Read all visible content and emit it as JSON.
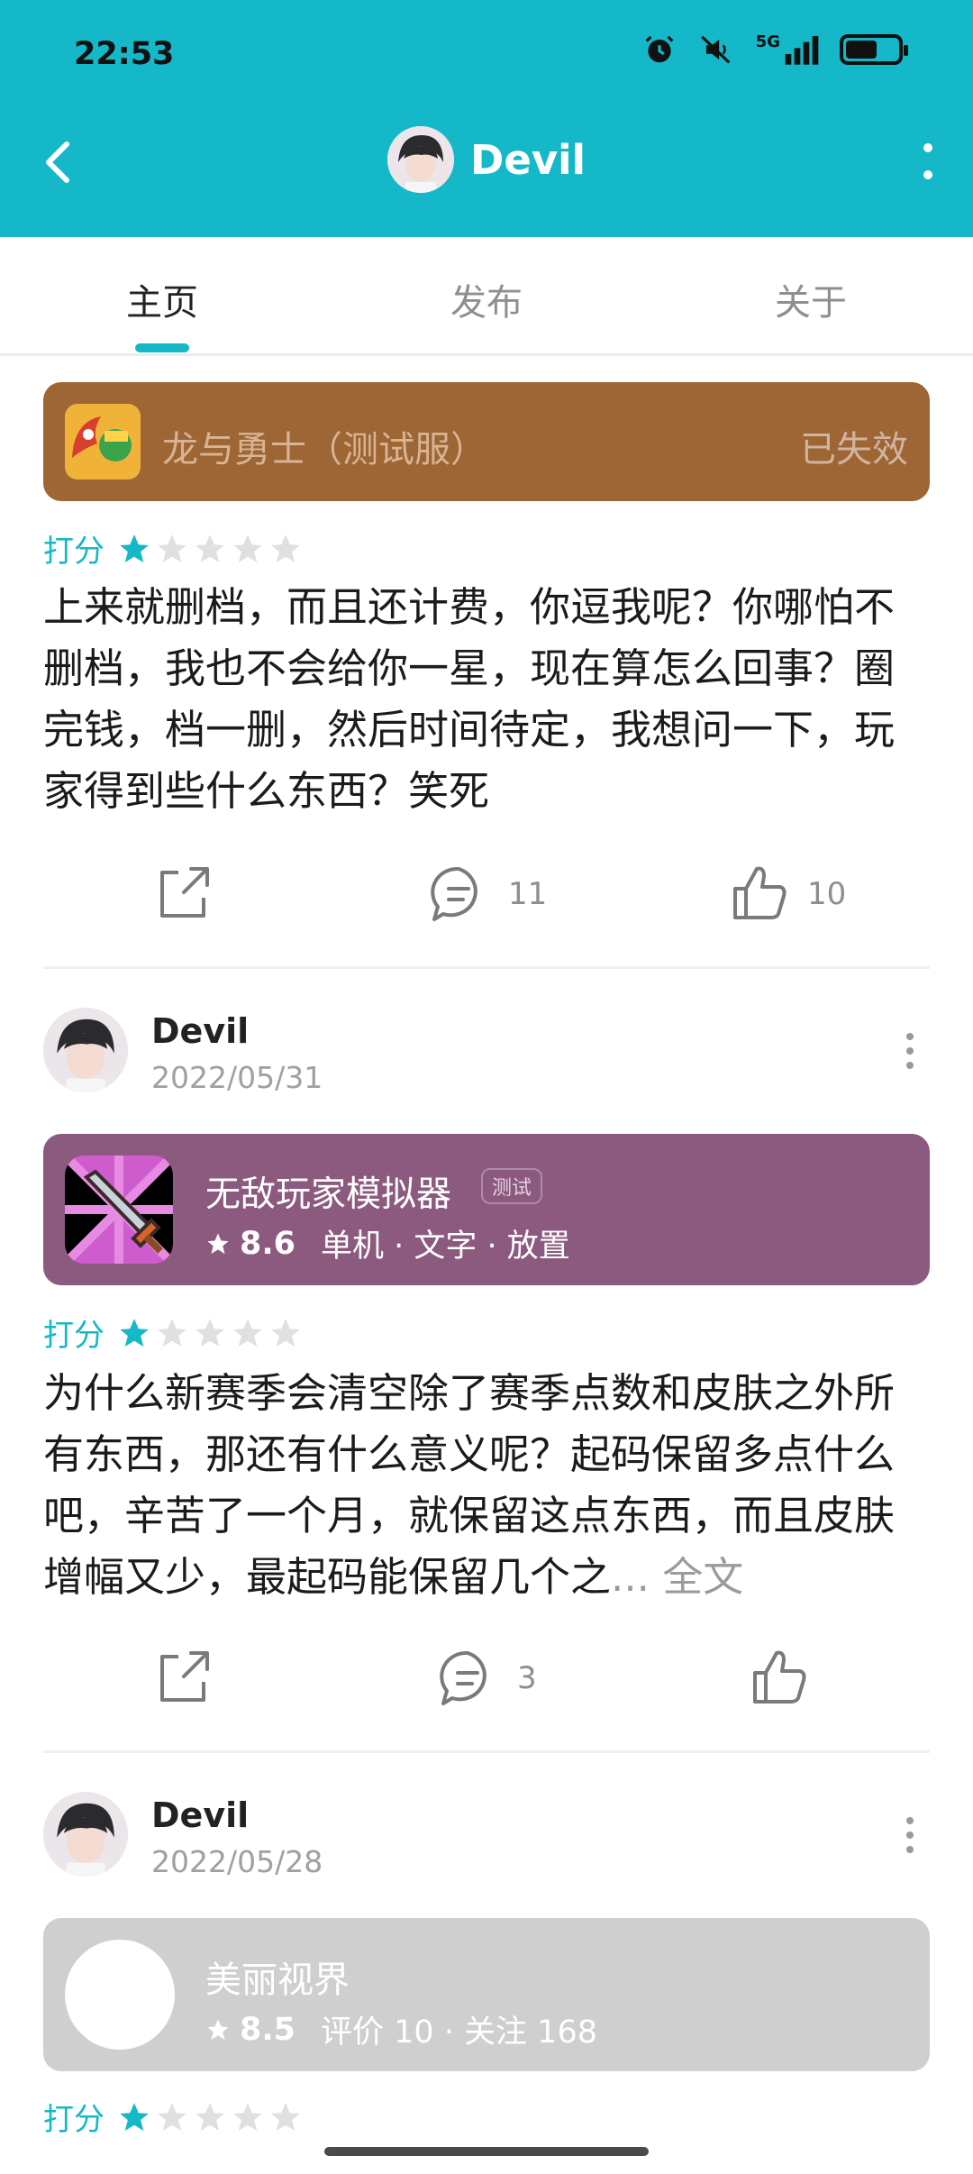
{
  "status_bar": {
    "time": "22:53",
    "network_label": "5G",
    "battery_level": 0.6,
    "icons": [
      "alarm-icon",
      "mute-icon",
      "signal-icon",
      "battery-icon"
    ]
  },
  "nav": {
    "title": "Devil",
    "back_icon": "back-arrow-icon",
    "more_icon": "more-vertical-icon"
  },
  "tabs": [
    {
      "label": "主页",
      "active": true
    },
    {
      "label": "发布",
      "active": false
    },
    {
      "label": "关于",
      "active": false
    }
  ],
  "reviews": [
    {
      "game": {
        "title": "龙与勇士（测试服）",
        "status": "已失效",
        "card_color": "#9e6535"
      },
      "rating_label": "打分",
      "stars": 1,
      "text": "上来就删档，而且还计费，你逗我呢？你哪怕不删档，我也不会给你一星，现在算怎么回事？圈完钱，档一删，然后时间待定，我想问一下，玩家得到些什么东西？笑死",
      "actions": {
        "comments": "11",
        "likes": "10"
      }
    },
    {
      "user": {
        "name": "Devil",
        "date": "2022/05/31"
      },
      "game": {
        "title": "无敌玩家模拟器",
        "badge": "测试",
        "score": "8.6",
        "tags": "单机 · 文字 · 放置",
        "card_color": "#8b5a7e"
      },
      "rating_label": "打分",
      "stars": 1,
      "text": "为什么新赛季会清空除了赛季点数和皮肤之外所有东西，那还有什么意义呢？起码保留多点什么吧，辛苦了一个月，就保留这点东西，而且皮肤增幅又少，最起码能保留几个之",
      "more_label": "... 全文",
      "actions": {
        "comments": "3",
        "likes": ""
      }
    },
    {
      "user": {
        "name": "Devil",
        "date": "2022/05/28"
      },
      "game": {
        "title": "美丽视界",
        "score": "8.5",
        "stats": "评价 10 · 关注 168",
        "card_color": "#cfcfcf"
      },
      "rating_label": "打分",
      "stars": 1
    }
  ],
  "colors": {
    "accent": "#15b8c8",
    "star_empty": "#e0e0e0"
  }
}
